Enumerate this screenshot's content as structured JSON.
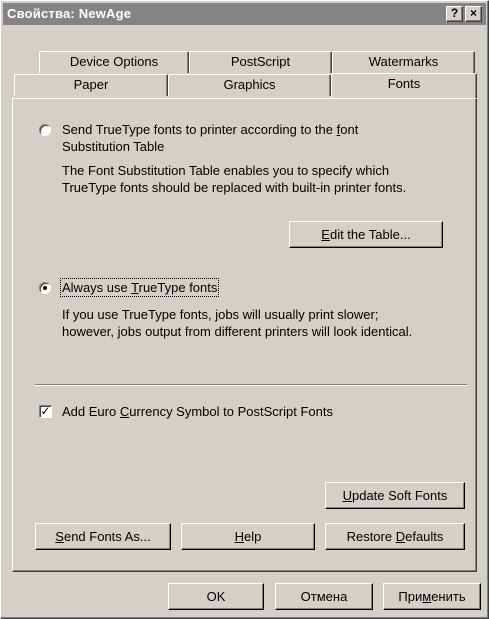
{
  "window": {
    "title": "Свойства: NewAge",
    "help_button": "?",
    "close_button": "×"
  },
  "tabs": {
    "row1": [
      "Device Options",
      "PostScript",
      "Watermarks"
    ],
    "row2": [
      "Paper",
      "Graphics",
      "Fonts"
    ],
    "active": "Fonts"
  },
  "font_options": {
    "substitution_radio": {
      "label_line1_pre": "Send TrueType fonts to printer according to the ",
      "label_line1_accel": "f",
      "label_line1_post": "ont",
      "label_line2": "Substitution Table",
      "selected": false
    },
    "substitution_desc_line1": "The Font Substitution Table enables you to specify which",
    "substitution_desc_line2": "TrueType fonts should be replaced with built-in printer fonts.",
    "edit_table_button": {
      "accel": "E",
      "rest": "dit the Table..."
    },
    "truetype_radio": {
      "label_pre": "Always use ",
      "label_accel": "T",
      "label_post": "rueType fonts",
      "selected": true
    },
    "truetype_desc_line1": "If you use TrueType fonts, jobs will usually print slower;",
    "truetype_desc_line2": "however, jobs output from different printers will look identical.",
    "euro_checkbox": {
      "label_pre": "Add Euro ",
      "label_accel": "C",
      "label_post": "urrency Symbol to PostScript Fonts",
      "checked": true
    },
    "update_soft_fonts_button": {
      "accel": "U",
      "rest": "pdate Soft Fonts"
    },
    "send_fonts_as_button": {
      "accel": "S",
      "rest": "end Fonts As..."
    },
    "help_button": {
      "accel": "H",
      "rest": "elp"
    },
    "restore_defaults_button": {
      "pre": "Restore ",
      "accel": "D",
      "rest": "efaults"
    }
  },
  "dialog_buttons": {
    "ok": "OK",
    "cancel": "Отмена",
    "apply_pre": "При",
    "apply_accel": "м",
    "apply_post": "енить"
  }
}
